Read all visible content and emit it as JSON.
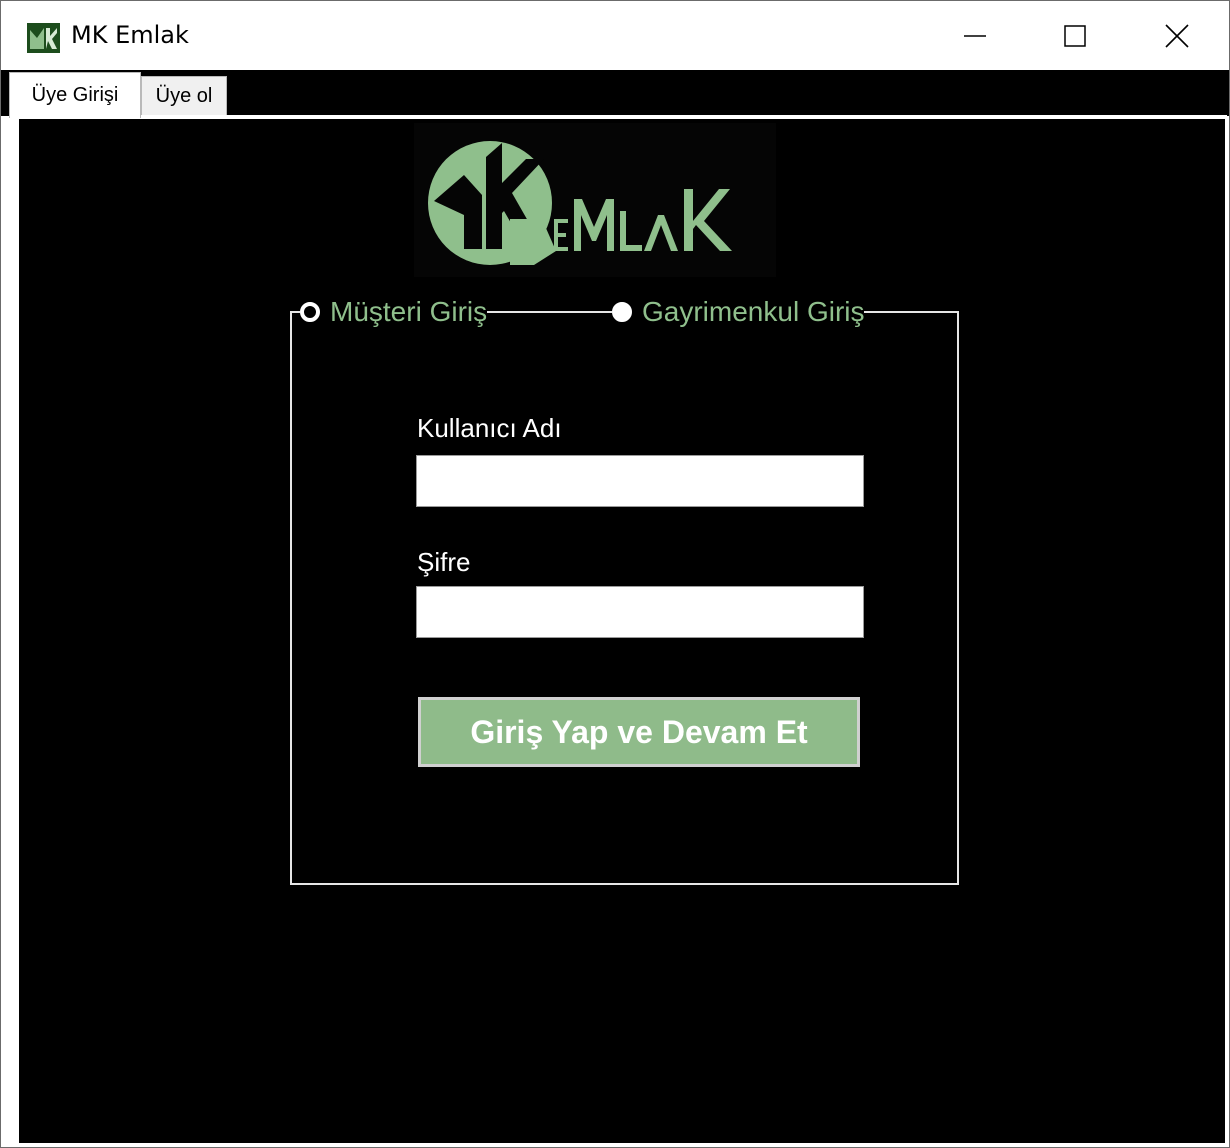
{
  "window": {
    "title": "MK Emlak",
    "icon": "mk-emlak-app-icon",
    "controls": [
      "minimize-icon",
      "maximize-icon",
      "close-icon"
    ]
  },
  "tabs": [
    {
      "label": "Üye Girişi",
      "active": true
    },
    {
      "label": "Üye ol",
      "active": false
    }
  ],
  "logo": {
    "text": "MK EMLAK",
    "icon": "mk-emlak-logo"
  },
  "login_type": {
    "options": [
      {
        "label": "Müşteri Giriş",
        "selected": false
      },
      {
        "label": "Gayrimenkul Giriş",
        "selected": true
      }
    ]
  },
  "form": {
    "username_label": "Kullanıcı Adı",
    "username_value": "",
    "password_label": "Şifre",
    "password_value": "",
    "submit_label": "Giriş Yap ve Devam Et"
  },
  "colors": {
    "accent": "#8fbb8a",
    "background": "#000000",
    "text": "#ffffff"
  }
}
